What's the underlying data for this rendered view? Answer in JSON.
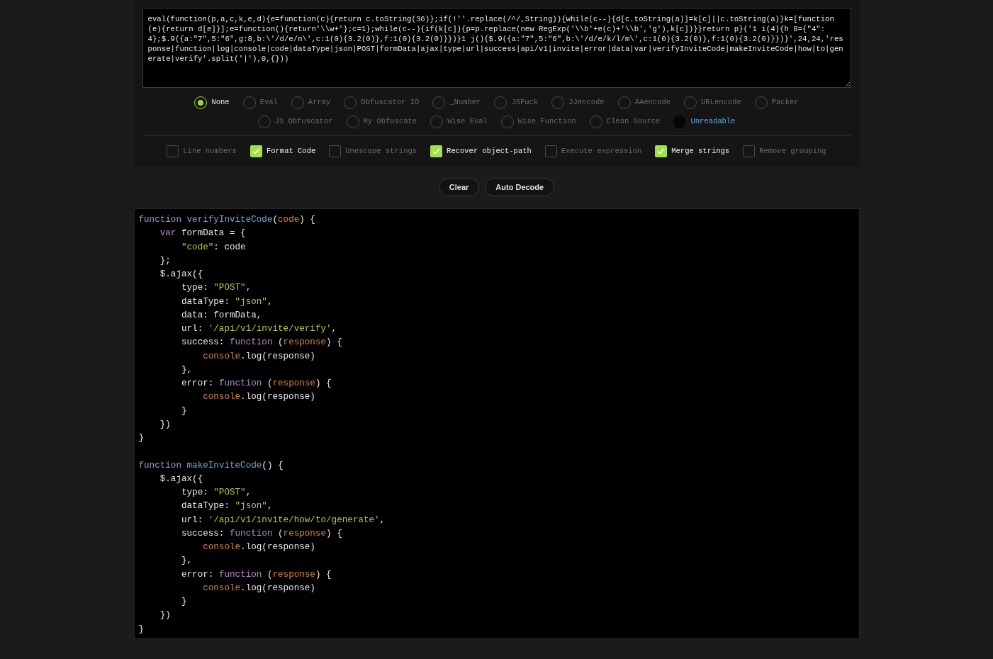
{
  "input": {
    "value": "eval(function(p,a,c,k,e,d){e=function(c){return c.toString(36)};if(!''.replace(/^/,String)){while(c--){d[c.toString(a)]=k[c]||c.toString(a)}k=[function(e){return d[e]}];e=function(){return'\\\\w+'};c=1};while(c--){if(k[c]){p=p.replace(new RegExp('\\\\b'+e(c)+'\\\\b','g'),k[c])}}return p}('1 i(4){h 8={\"4\":4};$.9({a:\"7\",5:\"6\",g:8,b:\\'/d/e/n\\',c:1(0){3.2(0)},f:1(0){3.2(0)}})}1 j(){$.9({a:\"7\",5:\"6\",b:\\'/d/e/k/l/m\\',c:1(0){3.2(0)},f:1(0){3.2(0)}})}',24,24,'response|function|log|console|code|dataType|json|POST|formData|ajax|type|url|success|api/v1|invite|error|data|var|verifyInviteCode|makeInviteCode|how|to|generate|verify'.split('|'),0,{}))"
  },
  "methods": [
    [
      {
        "label": "None",
        "selected": true,
        "highlighted": false
      },
      {
        "label": "Eval",
        "selected": false,
        "highlighted": false
      },
      {
        "label": "Array",
        "selected": false,
        "highlighted": false
      },
      {
        "label": "Obfuscator IO",
        "selected": false,
        "highlighted": false
      },
      {
        "label": "_Number",
        "selected": false,
        "highlighted": false
      },
      {
        "label": "JSFuck",
        "selected": false,
        "highlighted": false
      },
      {
        "label": "JJencode",
        "selected": false,
        "highlighted": false
      },
      {
        "label": "AAencode",
        "selected": false,
        "highlighted": false
      },
      {
        "label": "URLencode",
        "selected": false,
        "highlighted": false
      },
      {
        "label": "Packer",
        "selected": false,
        "highlighted": false
      }
    ],
    [
      {
        "label": "JS Obfuscator",
        "selected": false,
        "highlighted": false
      },
      {
        "label": "My Obfuscate",
        "selected": false,
        "highlighted": false
      },
      {
        "label": "Wise Eval",
        "selected": false,
        "highlighted": false
      },
      {
        "label": "Wise Function",
        "selected": false,
        "highlighted": false
      },
      {
        "label": "Clean Source",
        "selected": false,
        "highlighted": false
      },
      {
        "label": "Unreadable",
        "selected": false,
        "highlighted": true
      }
    ]
  ],
  "options": [
    {
      "label": "Line numbers",
      "checked": false
    },
    {
      "label": "Format Code",
      "checked": true
    },
    {
      "label": "Unescape strings",
      "checked": false
    },
    {
      "label": "Recover object-path",
      "checked": true
    },
    {
      "label": "Execute expression",
      "checked": false
    },
    {
      "label": "Merge strings",
      "checked": true
    },
    {
      "label": "Remove grouping",
      "checked": false
    }
  ],
  "buttons": [
    "Clear",
    "Auto Decode"
  ],
  "output": [
    {
      "kind": "code",
      "tokens": [
        {
          "kind": "keyword",
          "text": "function "
        },
        {
          "kind": "name",
          "text": "verifyInviteCode"
        },
        {
          "kind": "plain",
          "text": "("
        },
        {
          "kind": "param",
          "text": "code"
        },
        {
          "kind": "plain",
          "text": ") {"
        }
      ]
    },
    {
      "kind": "code",
      "tokens": [
        {
          "kind": "keyword",
          "text": "    var"
        },
        {
          "kind": "plain",
          "text": " formData = {"
        }
      ]
    },
    {
      "kind": "code",
      "tokens": [
        {
          "kind": "string",
          "text": "        \"code\""
        },
        {
          "kind": "plain",
          "text": ": code"
        }
      ]
    },
    {
      "kind": "code",
      "tokens": [
        {
          "kind": "plain",
          "text": "    };"
        }
      ]
    },
    {
      "kind": "code",
      "tokens": [
        {
          "kind": "plain",
          "text": "    $.ajax({"
        }
      ]
    },
    {
      "kind": "code",
      "tokens": [
        {
          "kind": "plain",
          "text": "        type: "
        },
        {
          "kind": "string",
          "text": "\"POST\""
        },
        {
          "kind": "plain",
          "text": ","
        }
      ]
    },
    {
      "kind": "code",
      "tokens": [
        {
          "kind": "plain",
          "text": "        dataType: "
        },
        {
          "kind": "string",
          "text": "\"json\""
        },
        {
          "kind": "plain",
          "text": ","
        }
      ]
    },
    {
      "kind": "code",
      "tokens": [
        {
          "kind": "plain",
          "text": "        data: formData,"
        }
      ]
    },
    {
      "kind": "code",
      "tokens": [
        {
          "kind": "plain",
          "text": "        url: "
        },
        {
          "kind": "string",
          "text": "'/api/v1/invite/verify'"
        },
        {
          "kind": "plain",
          "text": ","
        }
      ]
    },
    {
      "kind": "code",
      "tokens": [
        {
          "kind": "plain",
          "text": "        success: "
        },
        {
          "kind": "keyword",
          "text": "function "
        },
        {
          "kind": "plain",
          "text": "("
        },
        {
          "kind": "param",
          "text": "response"
        },
        {
          "kind": "plain",
          "text": ") {"
        }
      ]
    },
    {
      "kind": "code",
      "tokens": [
        {
          "kind": "param",
          "text": "            console"
        },
        {
          "kind": "plain",
          "text": ".log(response)"
        }
      ]
    },
    {
      "kind": "code",
      "tokens": [
        {
          "kind": "plain",
          "text": "        },"
        }
      ]
    },
    {
      "kind": "code",
      "tokens": [
        {
          "kind": "plain",
          "text": "        error: "
        },
        {
          "kind": "keyword",
          "text": "function "
        },
        {
          "kind": "plain",
          "text": "("
        },
        {
          "kind": "param",
          "text": "response"
        },
        {
          "kind": "plain",
          "text": ") {"
        }
      ]
    },
    {
      "kind": "code",
      "tokens": [
        {
          "kind": "param",
          "text": "            console"
        },
        {
          "kind": "plain",
          "text": ".log(response)"
        }
      ]
    },
    {
      "kind": "code",
      "tokens": [
        {
          "kind": "plain",
          "text": "        }"
        }
      ]
    },
    {
      "kind": "code",
      "tokens": [
        {
          "kind": "plain",
          "text": "    })"
        }
      ]
    },
    {
      "kind": "code",
      "tokens": [
        {
          "kind": "plain",
          "text": "}"
        }
      ]
    },
    {
      "kind": "blank"
    },
    {
      "kind": "code",
      "tokens": [
        {
          "kind": "keyword",
          "text": "function "
        },
        {
          "kind": "name",
          "text": "makeInviteCode"
        },
        {
          "kind": "plain",
          "text": "() {"
        }
      ]
    },
    {
      "kind": "code",
      "tokens": [
        {
          "kind": "plain",
          "text": "    $.ajax({"
        }
      ]
    },
    {
      "kind": "code",
      "tokens": [
        {
          "kind": "plain",
          "text": "        type: "
        },
        {
          "kind": "string",
          "text": "\"POST\""
        },
        {
          "kind": "plain",
          "text": ","
        }
      ]
    },
    {
      "kind": "code",
      "tokens": [
        {
          "kind": "plain",
          "text": "        dataType: "
        },
        {
          "kind": "string",
          "text": "\"json\""
        },
        {
          "kind": "plain",
          "text": ","
        }
      ]
    },
    {
      "kind": "code",
      "tokens": [
        {
          "kind": "plain",
          "text": "        url: "
        },
        {
          "kind": "string",
          "text": "'/api/v1/invite/how/to/generate'"
        },
        {
          "kind": "plain",
          "text": ","
        }
      ]
    },
    {
      "kind": "code",
      "tokens": [
        {
          "kind": "plain",
          "text": "        success: "
        },
        {
          "kind": "keyword",
          "text": "function "
        },
        {
          "kind": "plain",
          "text": "("
        },
        {
          "kind": "param",
          "text": "response"
        },
        {
          "kind": "plain",
          "text": ") {"
        }
      ]
    },
    {
      "kind": "code",
      "tokens": [
        {
          "kind": "param",
          "text": "            console"
        },
        {
          "kind": "plain",
          "text": ".log(response)"
        }
      ]
    },
    {
      "kind": "code",
      "tokens": [
        {
          "kind": "plain",
          "text": "        },"
        }
      ]
    },
    {
      "kind": "code",
      "tokens": [
        {
          "kind": "plain",
          "text": "        error: "
        },
        {
          "kind": "keyword",
          "text": "function "
        },
        {
          "kind": "plain",
          "text": "("
        },
        {
          "kind": "param",
          "text": "response"
        },
        {
          "kind": "plain",
          "text": ") {"
        }
      ]
    },
    {
      "kind": "code",
      "tokens": [
        {
          "kind": "param",
          "text": "            console"
        },
        {
          "kind": "plain",
          "text": ".log(response)"
        }
      ]
    },
    {
      "kind": "code",
      "tokens": [
        {
          "kind": "plain",
          "text": "        }"
        }
      ]
    },
    {
      "kind": "code",
      "tokens": [
        {
          "kind": "plain",
          "text": "    })"
        }
      ]
    },
    {
      "kind": "code",
      "tokens": [
        {
          "kind": "plain",
          "text": "}"
        }
      ]
    }
  ]
}
